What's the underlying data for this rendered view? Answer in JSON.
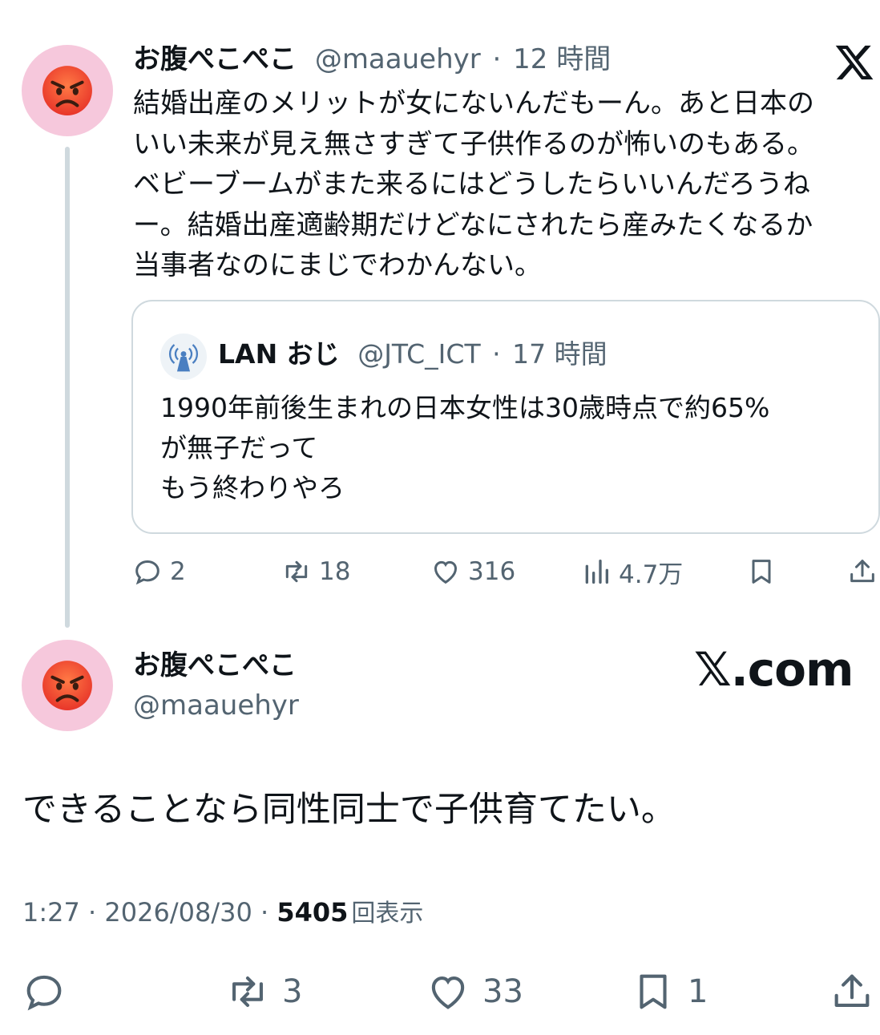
{
  "reply": {
    "display_name": "お腹ぺこぺこ",
    "handle": "@maauehyr",
    "separator": "·",
    "time": "12 時間",
    "avatar_icon": "angry-face-icon",
    "text_lines": [
      "結婚出産のメリットが女にないんだもーん。あと日本の",
      "いい未来が見え無さすぎて子供作るのが怖いのもある。",
      "ベビーブームがまた来るにはどうしたらいいんだろうね",
      "ー。結婚出産適齢期だけどなにされたら産みたくなるか",
      "当事者なのにまじでわかんない。"
    ],
    "quote": {
      "display_name": "LAN おじ",
      "handle": "@JTC_ICT",
      "separator": "·",
      "time": "17 時間",
      "avatar_icon": "antenna-icon",
      "text_lines": [
        "1990年前後生まれの日本女性は30歳時点で約65%",
        "が無子だって",
        "もう終わりやろ"
      ]
    },
    "actions": {
      "replies": "2",
      "reposts": "18",
      "likes": "316",
      "views": "4.7万"
    }
  },
  "main_post": {
    "display_name": "お腹ぺこぺこ",
    "handle": "@maauehyr",
    "brand": "𝕏.com",
    "text": "できることなら同性同士で子供育てたい。",
    "timestamp": "1:27 · 2026/08/30 · ",
    "views_count": "5405",
    "views_label": "回表示",
    "actions": {
      "reposts": "3",
      "likes": "33",
      "bookmarks": "1"
    }
  },
  "colors": {
    "text": "#0f1419",
    "muted": "#536471",
    "border": "#cfd9de",
    "avatar_bg": "#f6c8dc"
  }
}
